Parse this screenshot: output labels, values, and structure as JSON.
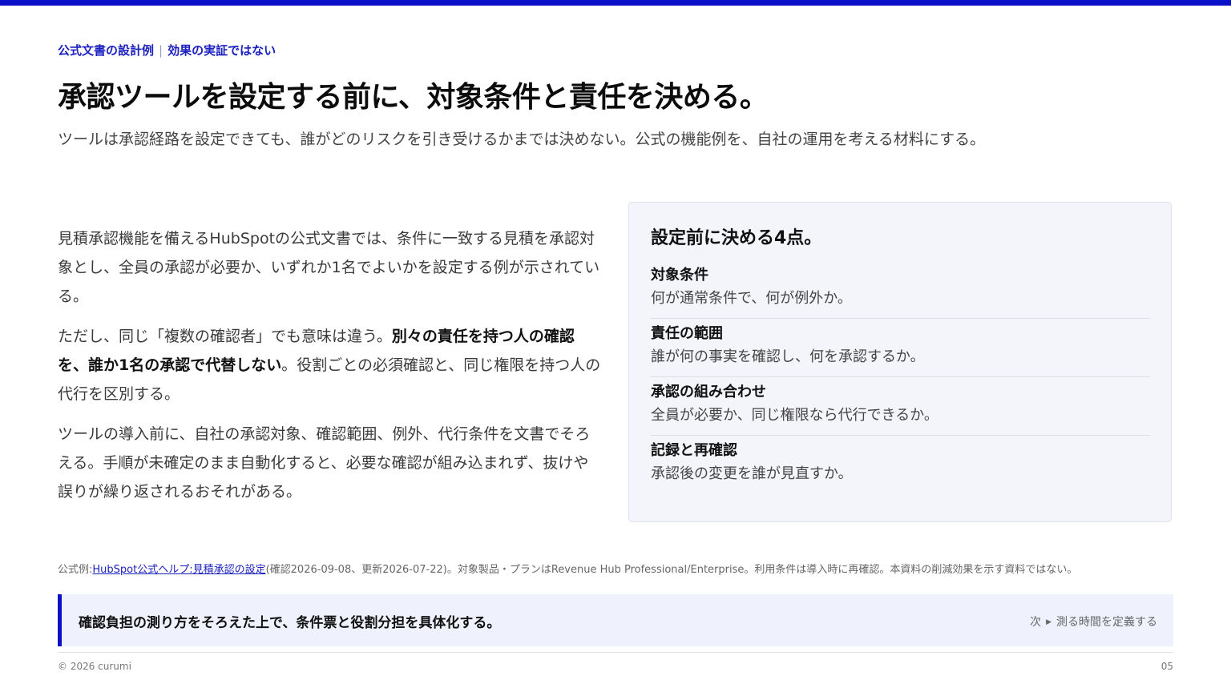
{
  "eyebrow": {
    "part1": "公式文書の設計例",
    "separator": "|",
    "part2": "効果の実証ではない"
  },
  "title": "承認ツールを設定する前に、対象条件と責任を決める。",
  "subtitle": "ツールは承認経路を設定できても、誰がどのリスクを引き受けるかまでは決めない。公式の機能例を、自社の運用を考える材料にする。",
  "body": {
    "p1": "見積承認機能を備えるHubSpotの公式文書では、条件に一致する見積を承認対象とし、全員の承認が必要か、いずれか1名でよいかを設定する例が示されている。",
    "p2_pre": "ただし、同じ「複数の確認者」でも意味は違う。",
    "p2_bold": "別々の責任を持つ人の確認を、誰か1名の承認で代替しない",
    "p2_post": "。役割ごとの必須確認と、同じ権限を持つ人の代行を区別する。",
    "p3": "ツールの導入前に、自社の承認対象、確認範囲、例外、代行条件を文書でそろえる。手順が未確定のまま自動化すると、必要な確認が組み込まれず、抜けや誤りが繰り返されるおそれがある。"
  },
  "card": {
    "title": "設定前に決める4点。",
    "items": [
      {
        "title": "対象条件",
        "desc": "何が通常条件で、何が例外か。"
      },
      {
        "title": "責任の範囲",
        "desc": "誰が何の事実を確認し、何を承認するか。"
      },
      {
        "title": "承認の組み合わせ",
        "desc": "全員が必要か、同じ権限なら代行できるか。"
      },
      {
        "title": "記録と再確認",
        "desc": "承認後の変更を誰が見直すか。"
      }
    ]
  },
  "source": {
    "prefix": "公式例:",
    "link": "HubSpot公式ヘルプ:見積承認の設定",
    "suffix": "(確認2026-09-08、更新2026-07-22)。対象製品・プランはRevenue Hub Professional/Enterprise。利用条件は導入時に再確認。本資料の削減効果を示す資料ではない。"
  },
  "callout": {
    "text": "確認負担の測り方をそろえた上で、条件票と役割分担を具体化する。",
    "next_prefix": "次",
    "next_label": "測る時間を定義する"
  },
  "footer": {
    "copyright": "© 2026 curumi",
    "page": "05"
  },
  "colors": {
    "accent": "#0a10c8",
    "card_bg": "#f4f5fa",
    "callout_bg": "#eff2fd"
  }
}
